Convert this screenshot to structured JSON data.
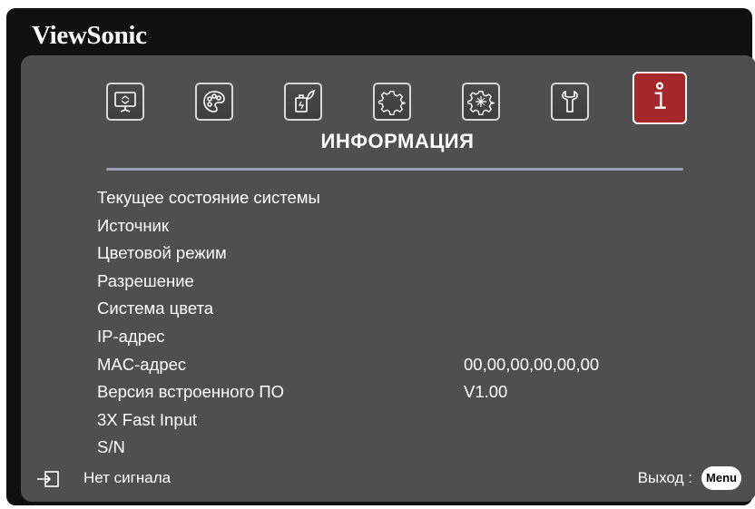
{
  "brand": "ViewSonic",
  "tabs": [
    {
      "icon": "display-icon",
      "active": false
    },
    {
      "icon": "palette-icon",
      "active": false
    },
    {
      "icon": "power-saving-icon",
      "active": false
    },
    {
      "icon": "basic-settings-icon",
      "active": false
    },
    {
      "icon": "advanced-settings-icon",
      "active": false
    },
    {
      "icon": "system-icon",
      "active": false
    },
    {
      "icon": "information-icon",
      "active": true
    }
  ],
  "menu_title": "ИНФОРМАЦИЯ",
  "rows": [
    {
      "label": "Текущее состояние системы",
      "value": ""
    },
    {
      "label": "Источник",
      "value": ""
    },
    {
      "label": "Цветовой режим",
      "value": ""
    },
    {
      "label": "Разрешение",
      "value": ""
    },
    {
      "label": "Система цвета",
      "value": ""
    },
    {
      "label": "IP-адрес",
      "value": ""
    },
    {
      "label": "MAC-адрес",
      "value": "00,00,00,00,00,00"
    },
    {
      "label": "Версия встроенного ПО",
      "value": "V1.00"
    },
    {
      "label": "3X Fast Input",
      "value": ""
    },
    {
      "label": "S/N",
      "value": ""
    }
  ],
  "footer": {
    "input_icon": "input-source-icon",
    "signal_text": "Нет сигнала",
    "exit_text": "Выход :",
    "menu_button": "Menu"
  },
  "colors": {
    "panel": "#4f4f4f",
    "frame": "#101010",
    "active_tab": "#a5262b",
    "divider": "#9da0b8",
    "text": "#ffffff"
  }
}
